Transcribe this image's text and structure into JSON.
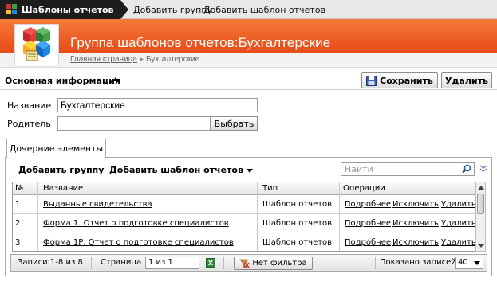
{
  "topbar": {
    "active_tab": "Шаблоны отчетов",
    "links": [
      "Добавить группу",
      "Добавить шаблон отчетов"
    ]
  },
  "header": {
    "title": "Группа шаблонов отчетов:Бухгалтерские",
    "breadcrumb": {
      "home": "Главная страница",
      "current": "Бухгалтерские"
    },
    "accent_color": "#e8501b"
  },
  "section": {
    "title": "Основная информация",
    "save_label": "Сохранить",
    "delete_label": "Удалить"
  },
  "form": {
    "name_label": "Название",
    "name_value": "Бухгалтерские",
    "parent_label": "Родитель",
    "parent_value": "",
    "choose_label": "Выбрать"
  },
  "tabs": {
    "children_label": "Дочерние элементы"
  },
  "toolbar": {
    "add_group": "Добавить группу",
    "add_template": "Добавить шаблон отчетов",
    "search_placeholder": "Найти"
  },
  "table": {
    "columns": [
      "№",
      "Название",
      "Тип",
      "Операции"
    ],
    "rows": [
      {
        "num": "1",
        "name": "Выданные свидетельства",
        "type": "Шаблон отчетов",
        "ops": [
          "Подробнее",
          "Исключить",
          "Удалить"
        ]
      },
      {
        "num": "2",
        "name": "Форма 1. Отчет о подготовке специалистов",
        "type": "Шаблон отчетов",
        "ops": [
          "Подробнее",
          "Исключить",
          "Удалить"
        ]
      },
      {
        "num": "3",
        "name": "Форма 1Р. Отчет о подготовке специалистов",
        "type": "Шаблон отчетов",
        "ops": [
          "Подробнее",
          "Исключить",
          "Удалить"
        ]
      }
    ]
  },
  "footer": {
    "records": "Записи:1-8 из 8",
    "page_label": "Страница",
    "page_value": "1 из 1",
    "xls_icon": "X",
    "no_filter": "Нет фильтра",
    "shown_label": "Показано записей:",
    "shown_value": "40"
  }
}
